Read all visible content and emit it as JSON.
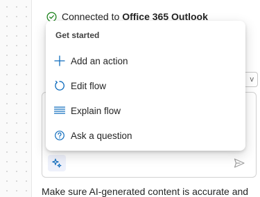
{
  "status": {
    "prefix": "Connected to",
    "service": "Office 365 Outlook"
  },
  "peek_button": {
    "label": "v"
  },
  "menu": {
    "heading": "Get started",
    "items": [
      {
        "label": "Add an action",
        "icon": "plus-icon"
      },
      {
        "label": "Edit flow",
        "icon": "refresh-circle-icon"
      },
      {
        "label": "Explain flow",
        "icon": "text-lines-icon"
      },
      {
        "label": "Ask a question",
        "icon": "question-circle-icon"
      }
    ]
  },
  "composer": {
    "copilot_icon": "sparkle-icon",
    "send_icon": "send-icon"
  },
  "disclaimer": "Make sure AI-generated content is accurate and",
  "colors": {
    "accent": "#0f6cbd",
    "success": "#107c10"
  }
}
